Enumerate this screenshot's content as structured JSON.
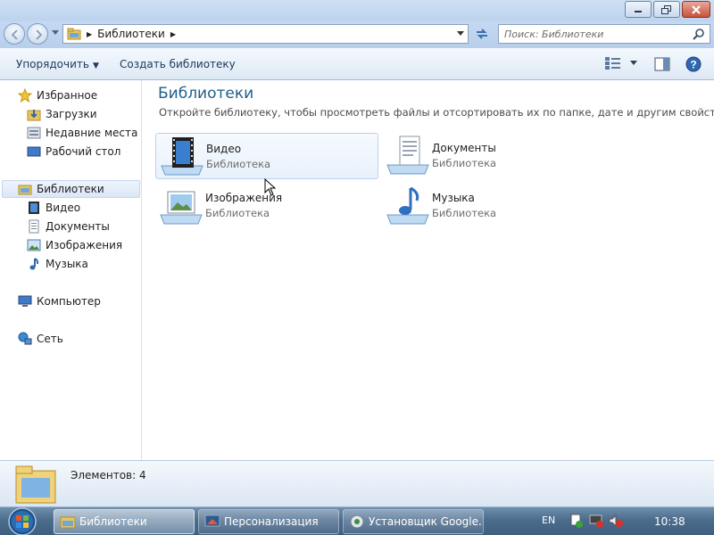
{
  "window": {
    "minimize_icon": "minimize-icon",
    "maximize_icon": "restore-icon",
    "close_icon": "close-icon"
  },
  "address": {
    "crumb": "Библиотеки",
    "search_placeholder": "Поиск: Библиотеки"
  },
  "toolbar": {
    "organize": "Упорядочить",
    "create_library": "Создать библиотеку"
  },
  "nav": {
    "favorites": "Избранное",
    "downloads": "Загрузки",
    "recent": "Недавние места",
    "desktop": "Рабочий стол",
    "libraries": "Библиотеки",
    "video": "Видео",
    "documents": "Документы",
    "pictures": "Изображения",
    "music": "Музыка",
    "computer": "Компьютер",
    "network": "Сеть"
  },
  "content": {
    "title": "Библиотеки",
    "description": "Откройте библиотеку, чтобы просмотреть файлы и отсортировать их по папке, дате и другим свойствам.",
    "libraries": [
      {
        "name": "Видео",
        "type": "Библиотека",
        "icon": "video-library-icon"
      },
      {
        "name": "Документы",
        "type": "Библиотека",
        "icon": "documents-library-icon"
      },
      {
        "name": "Изображения",
        "type": "Библиотека",
        "icon": "pictures-library-icon"
      },
      {
        "name": "Музыка",
        "type": "Библиотека",
        "icon": "music-library-icon"
      }
    ]
  },
  "details": {
    "count": "Элементов: 4"
  },
  "taskbar": {
    "items": [
      {
        "label": "Библиотеки",
        "active": true
      },
      {
        "label": "Персонализация",
        "active": false
      },
      {
        "label": "Установщик Google...",
        "active": false
      }
    ],
    "lang": "EN",
    "time": "10:38"
  },
  "colors": {
    "title_blue": "#1e5e8a",
    "toolbar_text": "#1e395b",
    "close_red": "#c7523c"
  }
}
